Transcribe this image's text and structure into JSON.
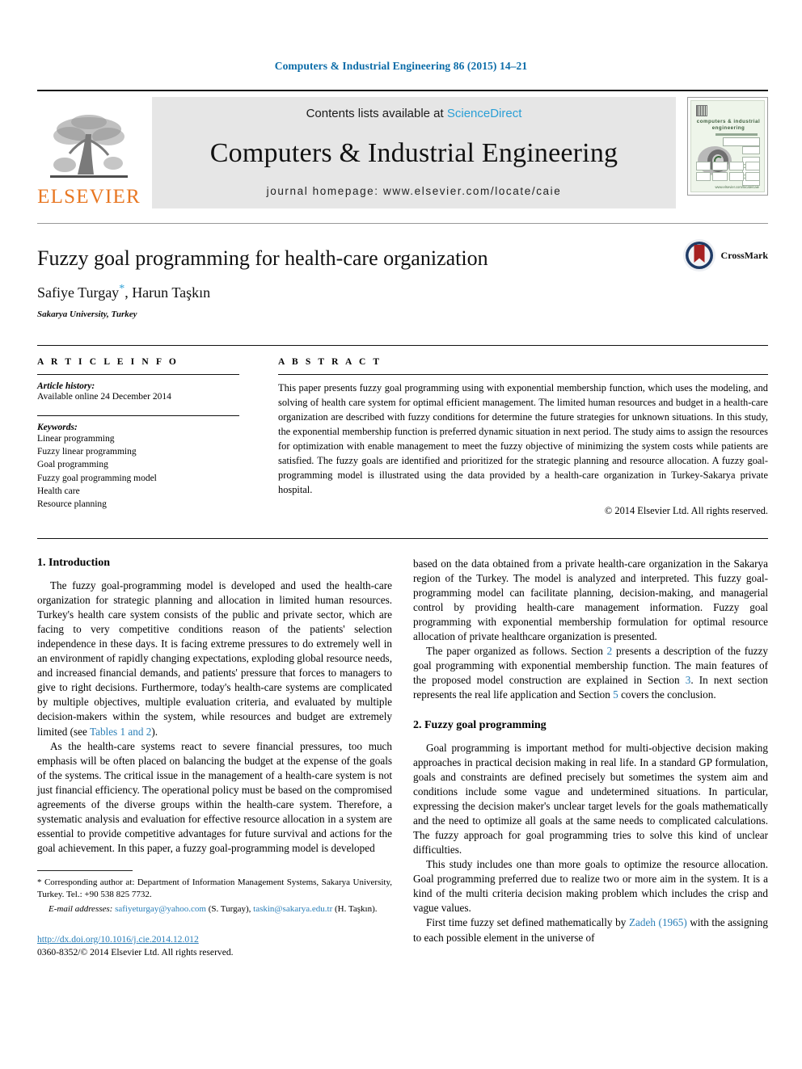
{
  "masthead": {
    "journal_reference": "Computers & Industrial Engineering 86 (2015) 14–21",
    "contents_prefix": "Contents lists available at ",
    "contents_link": "ScienceDirect",
    "journal_title": "Computers & Industrial Engineering",
    "homepage": "journal homepage: www.elsevier.com/locate/caie",
    "publisher_logo_text": "ELSEVIER",
    "cover": {
      "title": "computers & industrial engineering",
      "footer": "www.elsevier.com/locate/caie"
    },
    "accent_link_color": "#2a9fd6",
    "publisher_color": "#E87722"
  },
  "article": {
    "title": "Fuzzy goal programming for health-care organization",
    "authors": "Safiye Turgay",
    "corresponding_marker": "*",
    "authors_rest": ", Harun Taşkın",
    "affiliation": "Sakarya University, Turkey",
    "crossmark_label": "CrossMark"
  },
  "article_info": {
    "heading": "A R T I C L E    I N F O",
    "history_label": "Article history:",
    "history_value": "Available online 24 December 2014",
    "keywords_label": "Keywords:",
    "keywords": [
      "Linear programming",
      "Fuzzy linear programming",
      "Goal programming",
      "Fuzzy goal programming model",
      "Health care",
      "Resource planning"
    ]
  },
  "abstract": {
    "heading": "A B S T R A C T",
    "text": "This paper presents fuzzy goal programming using with exponential membership function, which uses the modeling, and solving of health care system for optimal efficient management. The limited human resources and budget in a health-care organization are described with fuzzy conditions for determine the future strategies for unknown situations. In this study, the exponential membership function is preferred dynamic situation in next period. The study aims to assign the resources for optimization with enable management to meet the fuzzy objective of minimizing the system costs while patients are satisfied. The fuzzy goals are identified and prioritized for the strategic planning and resource allocation. A fuzzy goal-programming model is illustrated using the data provided by a health-care organization in Turkey-Sakarya private hospital.",
    "copyright": "© 2014 Elsevier Ltd. All rights reserved."
  },
  "sections": {
    "intro_heading": "1. Introduction",
    "intro_p1_a": "The fuzzy goal-programming model is developed and used the health-care organization for strategic planning and allocation in limited human resources. Turkey's health care system consists of the public and private sector, which are facing to very competitive conditions reason of the patients' selection independence in these days. It is facing extreme pressures to do extremely well in an environment of rapidly changing expectations, exploding global resource needs, and increased financial demands, and patients' pressure that forces to managers to give to right decisions. Furthermore, today's health-care systems are complicated by multiple objectives, multiple evaluation criteria, and evaluated by multiple decision-makers within the system, while resources and budget are extremely limited (see ",
    "intro_p1_link": "Tables 1 and 2",
    "intro_p1_b": ").",
    "intro_p2": "As the health-care systems react to severe financial pressures, too much emphasis will be often placed on balancing the budget at the expense of the goals of the systems. The critical issue in the management of a health-care system is not just financial efficiency. The operational policy must be based on the compromised agreements of the diverse groups within the health-care system. Therefore, a systematic analysis and evaluation for effective resource allocation in a system are essential to provide competitive advantages for future survival and actions for the goal achievement. In this paper, a fuzzy goal-programming model is developed",
    "right_p1": "based on the data obtained from a private health-care organization in the Sakarya region of the Turkey. The model is analyzed and interpreted. This fuzzy goal-programming model can facilitate planning, decision-making, and managerial control by providing health-care management information. Fuzzy goal programming with exponential membership formulation for optimal resource allocation of private healthcare organization is presented.",
    "right_p2_a": "The paper organized as follows. Section ",
    "right_p2_link1": "2",
    "right_p2_b": " presents a description of the fuzzy goal programming with exponential membership function. The main features of the proposed model construction are explained in Section ",
    "right_p2_link2": "3",
    "right_p2_c": ". In next section represents the real life application and Section ",
    "right_p2_link3": "5",
    "right_p2_d": " covers the conclusion.",
    "fgp_heading": "2. Fuzzy goal programming",
    "fgp_p1": "Goal programming is important method for multi-objective decision making approaches in practical decision making in real life. In a standard GP formulation, goals and constraints are defined precisely but sometimes the system aim and conditions include some vague and undetermined situations. In particular, expressing the decision maker's unclear target levels for the goals mathematically and the need to optimize all goals at the same needs to complicated calculations. The fuzzy approach for goal programming tries to solve this kind of unclear difficulties.",
    "fgp_p2": "This study includes one than more goals to optimize the resource allocation. Goal programming preferred due to realize two or more aim in the system. It is a kind of the multi criteria decision making problem which includes the crisp and vague values.",
    "fgp_p3_a": "First time fuzzy set defined mathematically by ",
    "fgp_p3_link": "Zadeh (1965)",
    "fgp_p3_b": " with the assigning to each possible element in the universe of"
  },
  "footnote": {
    "corresponding": "* Corresponding author at: Department of Information Management Systems, Sakarya University, Turkey. Tel.: +90 538 825 7732.",
    "email_label": "E-mail addresses:",
    "email1": "safiyeturgay@yahoo.com",
    "email1_who": " (S. Turgay), ",
    "email2": "taskin@sakarya.edu.tr",
    "email2_who": " (H. Taşkın)."
  },
  "footer": {
    "doi": "http://dx.doi.org/10.1016/j.cie.2014.12.012",
    "issn_line": "0360-8352/© 2014 Elsevier Ltd. All rights reserved."
  }
}
